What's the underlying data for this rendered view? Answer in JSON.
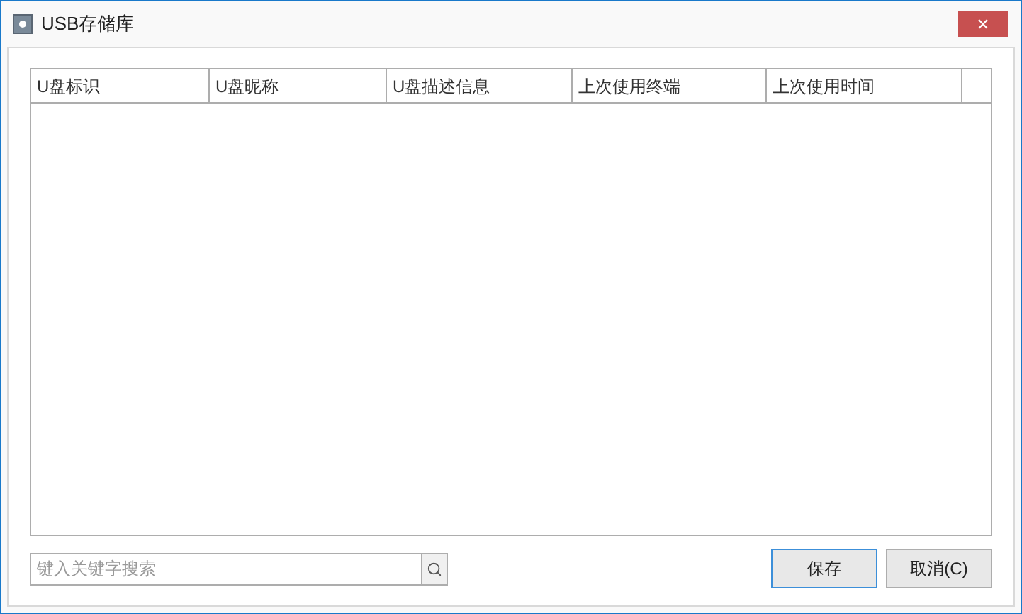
{
  "window": {
    "title": "USB存储库",
    "close": "×"
  },
  "table": {
    "columns": [
      "U盘标识",
      "U盘昵称",
      "U盘描述信息",
      "上次使用终端",
      "上次使用时间"
    ]
  },
  "search": {
    "placeholder": "键入关键字搜索"
  },
  "buttons": [
    {
      "label": "保存",
      "selected": true
    },
    {
      "label": "取消(C)",
      "selected": false
    }
  ]
}
